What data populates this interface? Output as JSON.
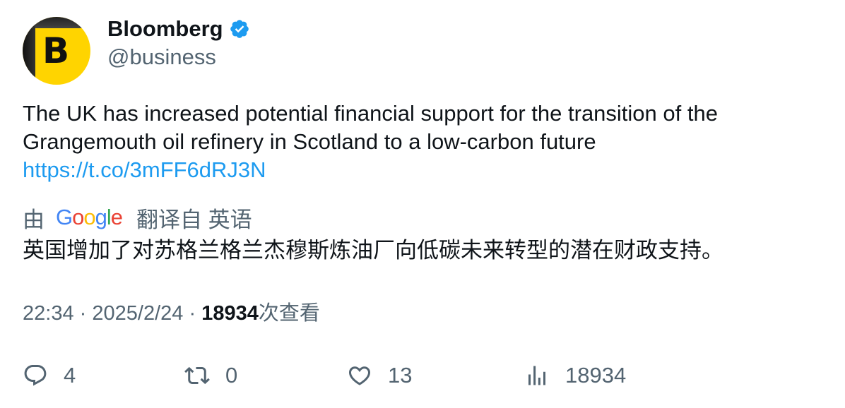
{
  "author": {
    "display_name": "Bloomberg",
    "handle": "@business",
    "avatar_letter": "B",
    "verified": true
  },
  "tweet": {
    "text": "The UK has increased potential financial support for the transition of the Grangemouth oil refinery in Scotland to a low-carbon future",
    "link": "https://t.co/3mFF6dRJ3N"
  },
  "translation": {
    "by_label": "由",
    "provider": "Google",
    "label": "翻译自 英语",
    "text": "英国增加了对苏格兰格兰杰穆斯炼油厂向低碳未来转型的潜在财政支持。"
  },
  "meta": {
    "time": "22:34",
    "separator": "·",
    "date": "2025/2/24",
    "views_count": "18934",
    "views_label": "次查看"
  },
  "actions": {
    "reply_count": "4",
    "retweet_count": "0",
    "like_count": "13",
    "views_count": "18934"
  },
  "colors": {
    "text": "#0f1419",
    "secondary": "#536471",
    "link": "#1d9bf0",
    "verified": "#1d9bf0",
    "avatar_bg": "#ffd400"
  },
  "icons": {
    "reply": "reply-icon",
    "retweet": "retweet-icon",
    "like": "heart-icon",
    "views": "views-bar-chart-icon",
    "verified": "verified-badge-icon"
  }
}
